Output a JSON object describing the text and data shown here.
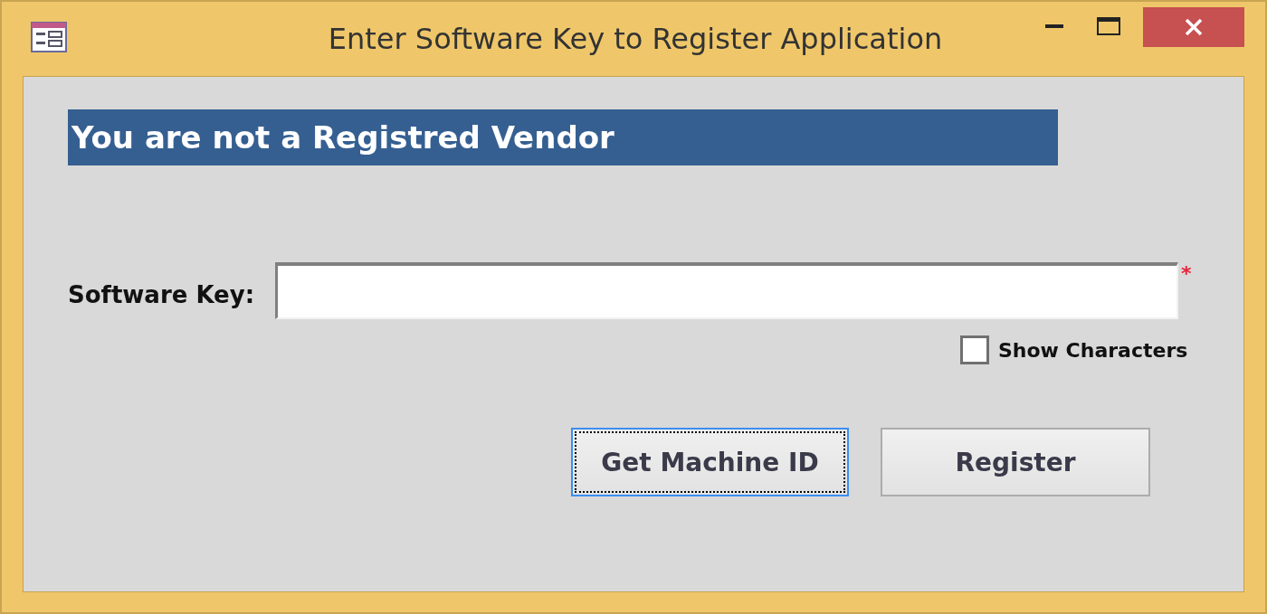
{
  "window": {
    "title": "Enter Software Key to Register Application"
  },
  "banner": "You are not a Registred Vendor",
  "software_key": {
    "label": "Software Key:",
    "required_mark": "*"
  },
  "show_characters": {
    "label": "Show Characters",
    "checked": false
  },
  "buttons": [
    {
      "label": "Get Machine ID",
      "focused": true
    },
    {
      "label": "Register",
      "focused": false
    }
  ]
}
